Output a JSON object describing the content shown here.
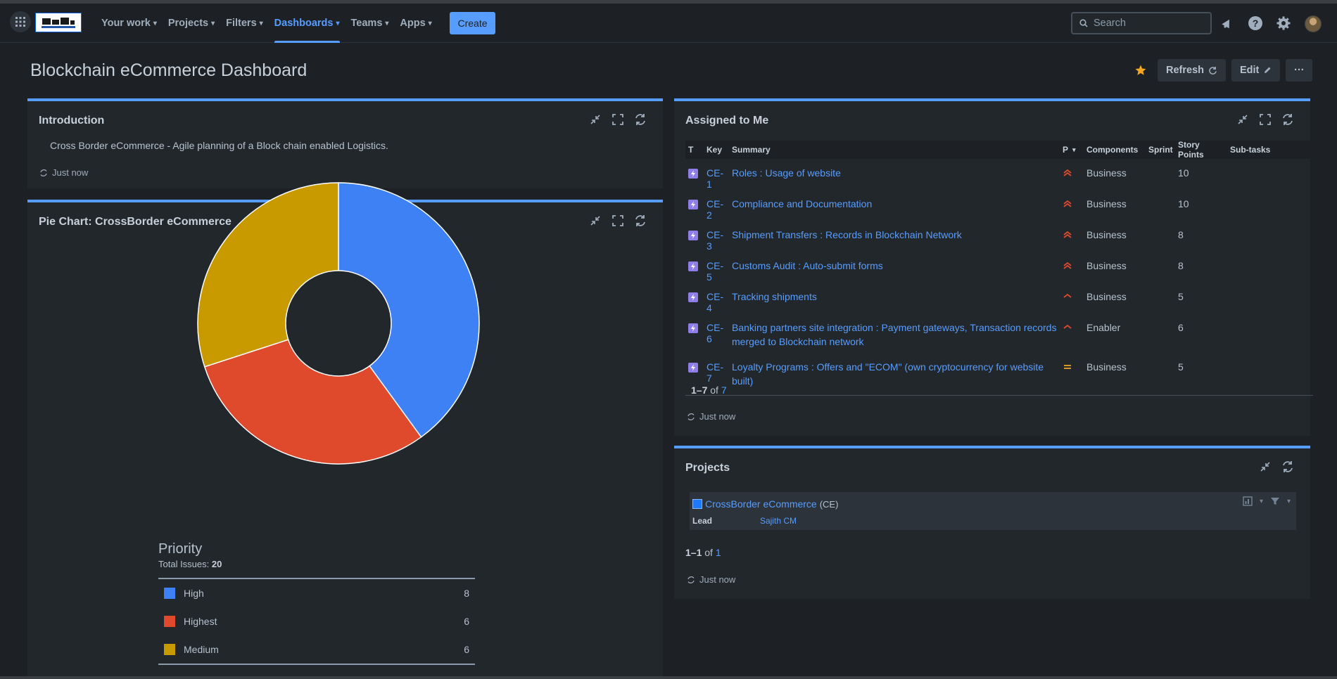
{
  "nav": {
    "items": [
      {
        "label": "Your work"
      },
      {
        "label": "Projects"
      },
      {
        "label": "Filters"
      },
      {
        "label": "Dashboards"
      },
      {
        "label": "Teams"
      },
      {
        "label": "Apps"
      }
    ],
    "active": "Dashboards",
    "create_label": "Create",
    "search_placeholder": "Search",
    "icons": [
      "app-switcher-icon",
      "notifications-icon",
      "help-icon",
      "settings-icon",
      "avatar"
    ]
  },
  "page": {
    "title": "Blockchain eCommerce Dashboard",
    "refresh_label": "Refresh",
    "edit_label": "Edit",
    "more_label": "···"
  },
  "colors": {
    "accent": "#579dff",
    "star": "#f5a623",
    "high": "#3d81f4",
    "highest": "#de4a2b",
    "medium": "#c99a00"
  },
  "intro": {
    "title": "Introduction",
    "text": "Cross Border eCommerce - Agile planning of a Block chain enabled Logistics.",
    "updated": "Just now"
  },
  "pie": {
    "title": "Pie Chart: CrossBorder eCommerce"
  },
  "chart_data": {
    "type": "pie",
    "title": "Priority",
    "total_label": "Total Issues:",
    "total": 20,
    "categories": [
      "High",
      "Highest",
      "Medium"
    ],
    "values": [
      8,
      6,
      6
    ],
    "colors": [
      "#3d81f4",
      "#de4a2b",
      "#c99a00"
    ]
  },
  "assigned": {
    "title": "Assigned to Me",
    "columns": [
      "T",
      "Key",
      "Summary",
      "P",
      "Components",
      "Sprint",
      "Story Points",
      "Sub-tasks"
    ],
    "rows": [
      {
        "key": "CE-1",
        "summary": "Roles : Usage of website",
        "priority": "highest",
        "component": "Business",
        "points": "10"
      },
      {
        "key": "CE-2",
        "summary": "Compliance and Documentation",
        "priority": "highest",
        "component": "Business",
        "points": "10"
      },
      {
        "key": "CE-3",
        "summary": "Shipment Transfers : Records in Blockchain Network",
        "priority": "highest",
        "component": "Business",
        "points": "8"
      },
      {
        "key": "CE-5",
        "summary": "Customs Audit : Auto-submit forms",
        "priority": "highest",
        "component": "Business",
        "points": "8"
      },
      {
        "key": "CE-4",
        "summary": "Tracking shipments",
        "priority": "high",
        "component": "Business",
        "points": "5"
      },
      {
        "key": "CE-6",
        "summary": "Banking partners site integration : Payment gateways, Transaction records merged to Blockchain network",
        "priority": "high",
        "component": "Enabler",
        "points": "6"
      },
      {
        "key": "CE-7",
        "summary": "Loyalty Programs : Offers and \"ECOM\" (own cryptocurrency for website built)",
        "priority": "medium",
        "component": "Business",
        "points": "5"
      }
    ],
    "pager_range": "1–7",
    "pager_of": "of",
    "pager_total": "7",
    "updated": "Just now"
  },
  "projects": {
    "title": "Projects",
    "name": "CrossBorder eCommerce",
    "key": "(CE)",
    "lead_label": "Lead",
    "lead": "Sajith CM",
    "pager_range": "1–1",
    "pager_of": "of",
    "pager_total": "1",
    "updated": "Just now"
  }
}
